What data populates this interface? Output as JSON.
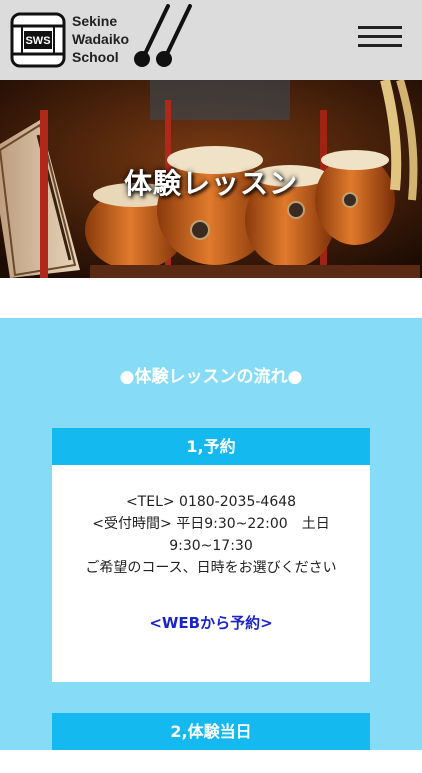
{
  "header": {
    "logo_badge": "SWS",
    "logo_lines": [
      "Sekine",
      "Wadaiko",
      "School"
    ],
    "menu_icon": "hamburger-menu-icon"
  },
  "hero": {
    "title": "体験レッスン"
  },
  "flow": {
    "heading": "●体験レッスンの流れ●",
    "steps": [
      {
        "title": "1,予約",
        "lines": [
          "<TEL> 0180-2035-4648",
          "<受付時間> 平日9:30~22:00　土日",
          "9:30~17:30",
          "ご希望のコース、日時をお選びください"
        ],
        "link": "<WEBから予約>"
      },
      {
        "title": "2,体験当日"
      }
    ]
  },
  "colors": {
    "header_bg": "#dcdcdc",
    "section_bg": "#86dcf7",
    "card_header": "#14b9f0",
    "link": "#1a24c8"
  }
}
